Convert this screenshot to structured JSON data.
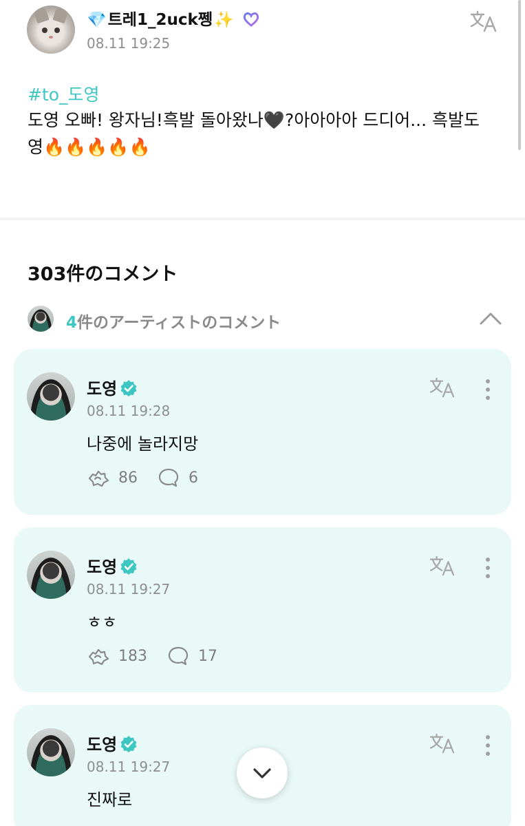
{
  "post": {
    "author": {
      "prefix_emoji": "💎",
      "name": "트레1_2uck쩽",
      "suffix_emoji": "✨"
    },
    "date": "08.11 19:25",
    "hashtag": "#to_도영",
    "body": "도영 오빠! 왕자님!흑발 돌아왔나🖤?아아아아 드디어... 흑발도영🔥🔥🔥🔥🔥"
  },
  "comments_header": {
    "count_label": "303件のコメント",
    "artist_count": "4",
    "artist_label": "件のアーティストのコメント"
  },
  "comments": [
    {
      "name": "도영",
      "date": "08.11 19:28",
      "text": "나중에 놀라지망",
      "likes": "86",
      "replies": "6"
    },
    {
      "name": "도영",
      "date": "08.11 19:27",
      "text": "ㅎㅎ",
      "likes": "183",
      "replies": "17"
    },
    {
      "name": "도영",
      "date": "08.11 19:27",
      "text": "진짜로"
    }
  ],
  "colors": {
    "accent": "#3ec7c2",
    "card_bg": "#e9f9f7",
    "muted": "#8e8e8e"
  },
  "icons": [
    "translate-icon",
    "verified-badge-icon",
    "more-vertical-icon",
    "like-icon",
    "reply-icon",
    "chevron-up-icon",
    "chevron-down-icon"
  ]
}
